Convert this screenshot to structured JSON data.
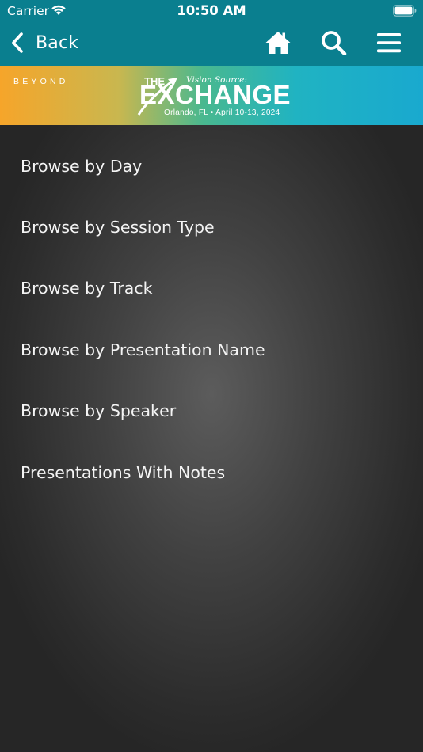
{
  "status_bar": {
    "carrier": "Carrier",
    "time": "10:50 AM"
  },
  "nav": {
    "back_label": "Back",
    "icons": [
      "home-icon",
      "search-icon",
      "menu-icon"
    ]
  },
  "banner": {
    "beyond": "BEYOND",
    "the": "THE",
    "vision_source": "Vision Source:",
    "exchange": "EXCHANGE",
    "location": "Orlando, FL • April 10-13, 2024"
  },
  "menu": {
    "items": [
      {
        "label": "Browse by Day"
      },
      {
        "label": "Browse by Session Type"
      },
      {
        "label": "Browse by Track"
      },
      {
        "label": "Browse by Presentation Name"
      },
      {
        "label": "Browse by Speaker"
      },
      {
        "label": "Presentations With Notes"
      }
    ]
  },
  "colors": {
    "header": "#0a7f8f",
    "text": "#f4f4f4",
    "background": "#2a2a2a"
  }
}
